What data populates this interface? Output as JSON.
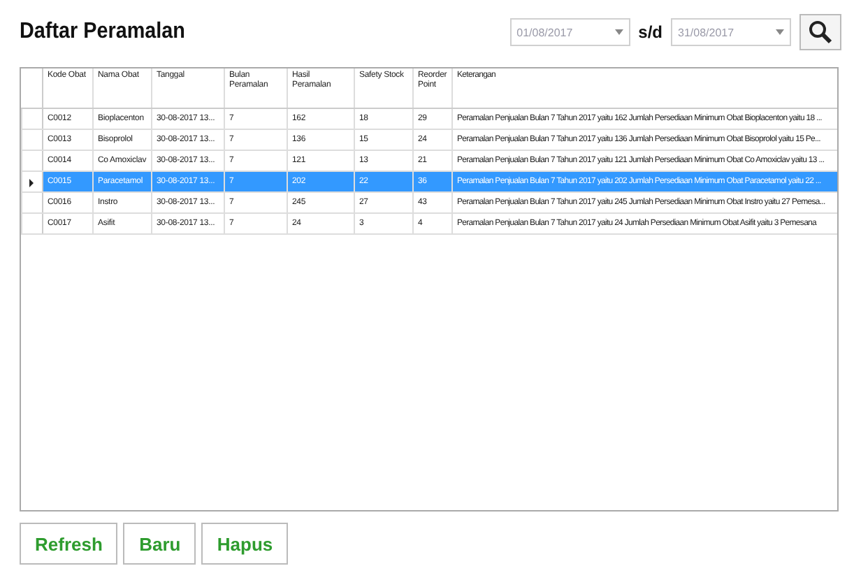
{
  "title": "Daftar Peramalan",
  "filter": {
    "date_from": "01/08/2017",
    "separator": "s/d",
    "date_to": "31/08/2017"
  },
  "table": {
    "columns": [
      "Kode Obat",
      "Nama Obat",
      "Tanggal",
      "Bulan Peramalan",
      "Hasil Peramalan",
      "Safety Stock",
      "Reorder Point",
      "Keterangan"
    ],
    "rows": [
      {
        "selected": false,
        "cells": [
          "C0012",
          "Bioplacenton",
          "30-08-2017 13...",
          "7",
          "162",
          "18",
          "29",
          "Peramalan Penjualan Bulan 7 Tahun 2017 yaitu 162 Jumlah Persediaan Minimum Obat Bioplacenton yaitu 18 ..."
        ]
      },
      {
        "selected": false,
        "cells": [
          "C0013",
          "Bisoprolol",
          "30-08-2017 13...",
          "7",
          "136",
          "15",
          "24",
          "Peramalan Penjualan Bulan 7 Tahun 2017 yaitu 136 Jumlah Persediaan Minimum Obat Bisoprolol yaitu 15 Pe..."
        ]
      },
      {
        "selected": false,
        "cells": [
          "C0014",
          "Co Amoxiclav",
          "30-08-2017 13...",
          "7",
          "121",
          "13",
          "21",
          "Peramalan Penjualan Bulan 7 Tahun 2017 yaitu 121 Jumlah Persediaan Minimum Obat Co Amoxiclav yaitu 13 ..."
        ]
      },
      {
        "selected": true,
        "cells": [
          "C0015",
          "Paracetamol",
          "30-08-2017 13...",
          "7",
          "202",
          "22",
          "36",
          "Peramalan Penjualan Bulan 7 Tahun 2017 yaitu 202 Jumlah Persediaan Minimum Obat Paracetamol yaitu 22 ..."
        ]
      },
      {
        "selected": false,
        "cells": [
          "C0016",
          "Instro",
          "30-08-2017 13...",
          "7",
          "245",
          "27",
          "43",
          "Peramalan Penjualan Bulan 7 Tahun 2017 yaitu 245 Jumlah Persediaan Minimum Obat Instro yaitu 27 Pemesa..."
        ]
      },
      {
        "selected": false,
        "cells": [
          "C0017",
          "Asifit",
          "30-08-2017 13...",
          "7",
          "24",
          "3",
          "4",
          "Peramalan Penjualan Bulan 7 Tahun 2017 yaitu 24 Jumlah Persediaan Minimum Obat Asifit yaitu 3 Pemesana"
        ]
      }
    ]
  },
  "buttons": [
    "Refresh",
    "Baru",
    "Hapus"
  ]
}
